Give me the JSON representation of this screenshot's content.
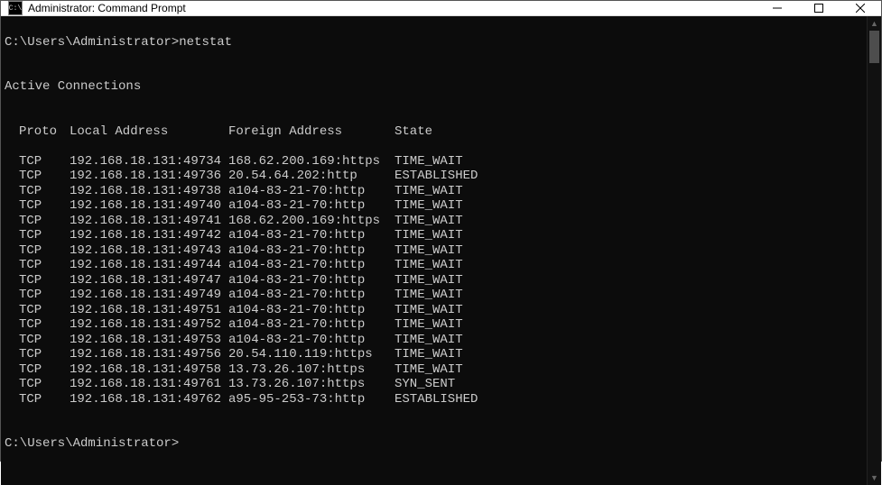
{
  "window": {
    "title": "Administrator: Command Prompt"
  },
  "terminal": {
    "prompt1_path": "C:\\Users\\Administrator>",
    "prompt1_cmd": "netstat",
    "blank": "",
    "section_title": "Active Connections",
    "header": {
      "proto": "Proto",
      "local": "Local Address",
      "foreign": "Foreign Address",
      "state": "State"
    },
    "rows": [
      {
        "proto": "TCP",
        "local": "192.168.18.131:49734",
        "foreign": "168.62.200.169:https",
        "state": "TIME_WAIT"
      },
      {
        "proto": "TCP",
        "local": "192.168.18.131:49736",
        "foreign": "20.54.64.202:http",
        "state": "ESTABLISHED"
      },
      {
        "proto": "TCP",
        "local": "192.168.18.131:49738",
        "foreign": "a104-83-21-70:http",
        "state": "TIME_WAIT"
      },
      {
        "proto": "TCP",
        "local": "192.168.18.131:49740",
        "foreign": "a104-83-21-70:http",
        "state": "TIME_WAIT"
      },
      {
        "proto": "TCP",
        "local": "192.168.18.131:49741",
        "foreign": "168.62.200.169:https",
        "state": "TIME_WAIT"
      },
      {
        "proto": "TCP",
        "local": "192.168.18.131:49742",
        "foreign": "a104-83-21-70:http",
        "state": "TIME_WAIT"
      },
      {
        "proto": "TCP",
        "local": "192.168.18.131:49743",
        "foreign": "a104-83-21-70:http",
        "state": "TIME_WAIT"
      },
      {
        "proto": "TCP",
        "local": "192.168.18.131:49744",
        "foreign": "a104-83-21-70:http",
        "state": "TIME_WAIT"
      },
      {
        "proto": "TCP",
        "local": "192.168.18.131:49747",
        "foreign": "a104-83-21-70:http",
        "state": "TIME_WAIT"
      },
      {
        "proto": "TCP",
        "local": "192.168.18.131:49749",
        "foreign": "a104-83-21-70:http",
        "state": "TIME_WAIT"
      },
      {
        "proto": "TCP",
        "local": "192.168.18.131:49751",
        "foreign": "a104-83-21-70:http",
        "state": "TIME_WAIT"
      },
      {
        "proto": "TCP",
        "local": "192.168.18.131:49752",
        "foreign": "a104-83-21-70:http",
        "state": "TIME_WAIT"
      },
      {
        "proto": "TCP",
        "local": "192.168.18.131:49753",
        "foreign": "a104-83-21-70:http",
        "state": "TIME_WAIT"
      },
      {
        "proto": "TCP",
        "local": "192.168.18.131:49756",
        "foreign": "20.54.110.119:https",
        "state": "TIME_WAIT"
      },
      {
        "proto": "TCP",
        "local": "192.168.18.131:49758",
        "foreign": "13.73.26.107:https",
        "state": "TIME_WAIT"
      },
      {
        "proto": "TCP",
        "local": "192.168.18.131:49761",
        "foreign": "13.73.26.107:https",
        "state": "SYN_SENT"
      },
      {
        "proto": "TCP",
        "local": "192.168.18.131:49762",
        "foreign": "a95-95-253-73:http",
        "state": "ESTABLISHED"
      }
    ],
    "prompt2_path": "C:\\Users\\Administrator>"
  }
}
